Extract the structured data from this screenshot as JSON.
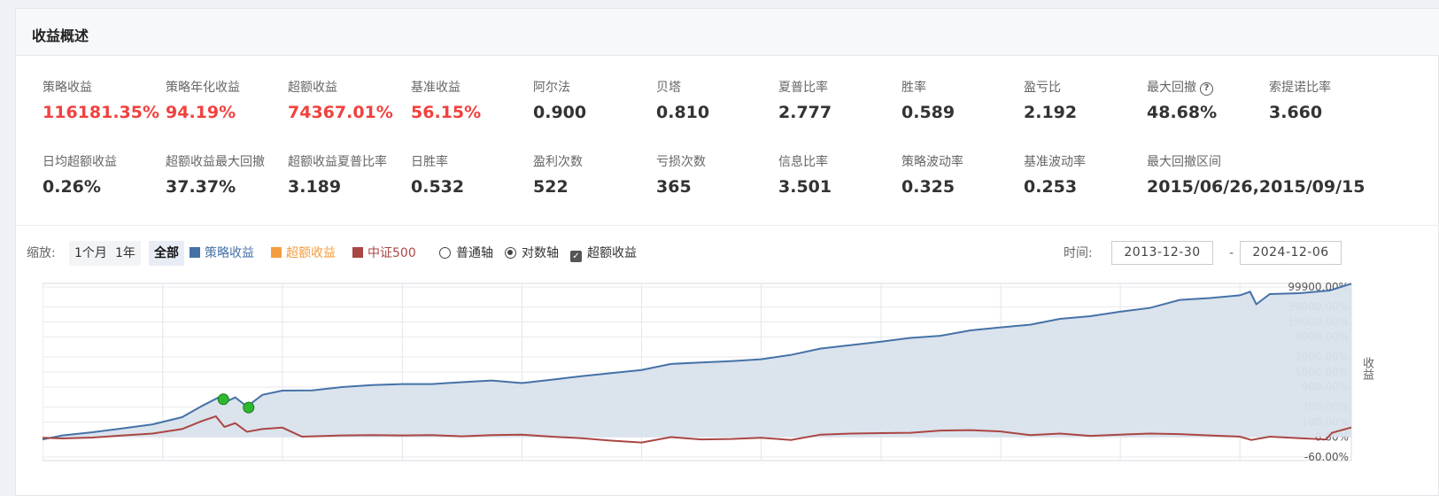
{
  "panel": {
    "title": "收益概述"
  },
  "metrics_row1": [
    {
      "label": "策略收益",
      "value": "116181.35%",
      "red": true
    },
    {
      "label": "策略年化收益",
      "value": "94.19%",
      "red": true
    },
    {
      "label": "超额收益",
      "value": "74367.01%",
      "red": true
    },
    {
      "label": "基准收益",
      "value": "56.15%",
      "red": true
    },
    {
      "label": "阿尔法",
      "value": "0.900",
      "red": false
    },
    {
      "label": "贝塔",
      "value": "0.810",
      "red": false
    },
    {
      "label": "夏普比率",
      "value": "2.777",
      "red": false
    },
    {
      "label": "胜率",
      "value": "0.589",
      "red": false
    },
    {
      "label": "盈亏比",
      "value": "2.192",
      "red": false
    },
    {
      "label": "最大回撤",
      "value": "48.68%",
      "red": false,
      "help": "?"
    },
    {
      "label": "索提诺比率",
      "value": "3.660",
      "red": false
    }
  ],
  "metrics_row2": [
    {
      "label": "日均超额收益",
      "value": "0.26%"
    },
    {
      "label": "超额收益最大回撤",
      "value": "37.37%"
    },
    {
      "label": "超额收益夏普比率",
      "value": "3.189"
    },
    {
      "label": "日胜率",
      "value": "0.532"
    },
    {
      "label": "盈利次数",
      "value": "522"
    },
    {
      "label": "亏损次数",
      "value": "365"
    },
    {
      "label": "信息比率",
      "value": "3.501"
    },
    {
      "label": "策略波动率",
      "value": "0.325"
    },
    {
      "label": "基准波动率",
      "value": "0.253"
    },
    {
      "label": "最大回撤区间",
      "value": "2015/06/26,2015/09/15"
    }
  ],
  "toolbar": {
    "zoom_label": "缩放:",
    "zoom_buttons": [
      "1个月",
      "1年",
      "全部"
    ],
    "zoom_active": "全部",
    "legend": [
      {
        "name": "策略收益",
        "color": "#4572a7"
      },
      {
        "name": "超额收益",
        "color": "#f59c3c"
      },
      {
        "name": "中证500",
        "color": "#aa4643"
      }
    ],
    "axis_options": [
      "普通轴",
      "对数轴"
    ],
    "axis_selected": "对数轴",
    "excess_checkbox": "超额收益",
    "excess_checked": true,
    "time_label": "时间:",
    "date_from": "2013-12-30",
    "date_sep": "-",
    "date_to": "2024-12-06"
  },
  "chart_data": {
    "type": "line",
    "ylabel": "收益",
    "y_scale": "log",
    "yticks": [
      "99900.00%",
      "39900.00%",
      "19900.00%",
      "9900.00%",
      "3900.00%",
      "1900.00%",
      "900.00%",
      "300.00%",
      "100.00%",
      "0.00%",
      "-60.00%"
    ],
    "x_range": [
      "2013-12-30",
      "2024-12-06"
    ],
    "area_fill": "#d9e1ec",
    "series": [
      {
        "name": "策略收益",
        "color": "#4572a7",
        "points": [
          [
            "2013-12-30",
            -10
          ],
          [
            "2014-03-01",
            8
          ],
          [
            "2014-06-01",
            25
          ],
          [
            "2014-09-01",
            50
          ],
          [
            "2014-12-01",
            80
          ],
          [
            "2015-03-01",
            150
          ],
          [
            "2015-05-01",
            320
          ],
          [
            "2015-06-20",
            520
          ],
          [
            "2015-07-15",
            420
          ],
          [
            "2015-08-10",
            520
          ],
          [
            "2015-09-15",
            310
          ],
          [
            "2015-11-01",
            600
          ],
          [
            "2016-01-01",
            750
          ],
          [
            "2016-04-01",
            760
          ],
          [
            "2016-07-01",
            900
          ],
          [
            "2016-10-01",
            1000
          ],
          [
            "2017-01-01",
            1050
          ],
          [
            "2017-04-01",
            1050
          ],
          [
            "2017-07-01",
            1150
          ],
          [
            "2017-10-01",
            1250
          ],
          [
            "2018-01-01",
            1100
          ],
          [
            "2018-04-01",
            1300
          ],
          [
            "2018-07-01",
            1550
          ],
          [
            "2018-10-01",
            1800
          ],
          [
            "2019-01-01",
            2100
          ],
          [
            "2019-04-01",
            2800
          ],
          [
            "2019-07-01",
            3000
          ],
          [
            "2019-10-01",
            3200
          ],
          [
            "2020-01-01",
            3500
          ],
          [
            "2020-04-01",
            4300
          ],
          [
            "2020-07-01",
            5800
          ],
          [
            "2020-10-01",
            6800
          ],
          [
            "2021-01-01",
            8000
          ],
          [
            "2021-04-01",
            9500
          ],
          [
            "2021-07-01",
            10500
          ],
          [
            "2021-10-01",
            13500
          ],
          [
            "2022-01-01",
            15500
          ],
          [
            "2022-04-01",
            17500
          ],
          [
            "2022-07-01",
            23000
          ],
          [
            "2022-10-01",
            26000
          ],
          [
            "2023-01-01",
            32000
          ],
          [
            "2023-04-01",
            38000
          ],
          [
            "2023-07-01",
            55000
          ],
          [
            "2023-10-01",
            60000
          ],
          [
            "2024-01-01",
            68000
          ],
          [
            "2024-02-01",
            80000
          ],
          [
            "2024-02-20",
            45000
          ],
          [
            "2024-04-01",
            72000
          ],
          [
            "2024-07-01",
            75000
          ],
          [
            "2024-10-01",
            85000
          ],
          [
            "2024-12-06",
            116181.35
          ]
        ]
      },
      {
        "name": "中证500",
        "color": "#aa4643",
        "points": [
          [
            "2013-12-30",
            -3
          ],
          [
            "2014-03-01",
            -6
          ],
          [
            "2014-06-01",
            -2
          ],
          [
            "2014-09-01",
            8
          ],
          [
            "2014-12-01",
            18
          ],
          [
            "2015-03-01",
            45
          ],
          [
            "2015-05-01",
            110
          ],
          [
            "2015-06-12",
            160
          ],
          [
            "2015-07-08",
            60
          ],
          [
            "2015-08-10",
            90
          ],
          [
            "2015-09-15",
            28
          ],
          [
            "2015-11-01",
            45
          ],
          [
            "2016-01-01",
            55
          ],
          [
            "2016-03-01",
            2
          ],
          [
            "2016-07-01",
            8
          ],
          [
            "2016-10-01",
            10
          ],
          [
            "2017-01-01",
            8
          ],
          [
            "2017-04-01",
            10
          ],
          [
            "2017-07-01",
            4
          ],
          [
            "2017-10-01",
            10
          ],
          [
            "2018-01-01",
            12
          ],
          [
            "2018-04-01",
            2
          ],
          [
            "2018-07-01",
            -5
          ],
          [
            "2018-10-01",
            -15
          ],
          [
            "2019-01-01",
            -22
          ],
          [
            "2019-04-01",
            0
          ],
          [
            "2019-07-01",
            -10
          ],
          [
            "2019-10-01",
            -8
          ],
          [
            "2020-01-01",
            -3
          ],
          [
            "2020-04-01",
            -12
          ],
          [
            "2020-07-01",
            12
          ],
          [
            "2020-10-01",
            18
          ],
          [
            "2021-01-01",
            20
          ],
          [
            "2021-04-01",
            22
          ],
          [
            "2021-07-01",
            35
          ],
          [
            "2021-10-01",
            38
          ],
          [
            "2022-01-01",
            30
          ],
          [
            "2022-04-01",
            10
          ],
          [
            "2022-07-01",
            18
          ],
          [
            "2022-10-01",
            6
          ],
          [
            "2023-01-01",
            12
          ],
          [
            "2023-04-01",
            18
          ],
          [
            "2023-07-01",
            15
          ],
          [
            "2023-10-01",
            8
          ],
          [
            "2024-01-01",
            2
          ],
          [
            "2024-02-05",
            -12
          ],
          [
            "2024-04-01",
            2
          ],
          [
            "2024-07-01",
            -5
          ],
          [
            "2024-09-20",
            -10
          ],
          [
            "2024-10-08",
            22
          ],
          [
            "2024-12-06",
            56.15
          ]
        ]
      }
    ],
    "markers": [
      {
        "date": "2015-07-05",
        "series": "策略收益",
        "value": 470,
        "color": "#2eb82e"
      },
      {
        "date": "2015-09-20",
        "series": "策略收益",
        "value": 290,
        "color": "#2eb82e"
      }
    ]
  }
}
